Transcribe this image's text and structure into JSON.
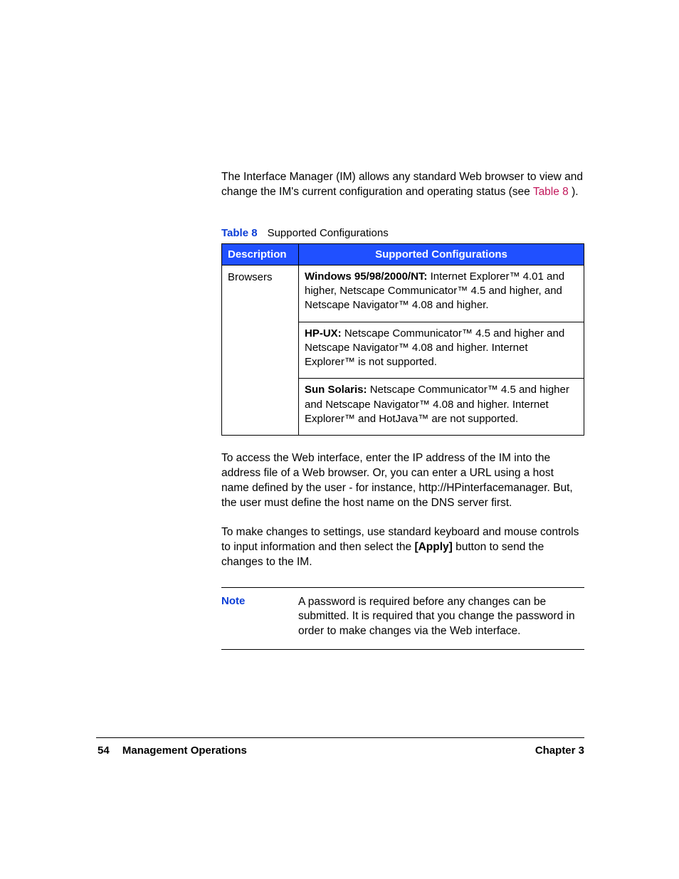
{
  "intro": {
    "before_ref": "The Interface Manager (IM) allows any standard Web browser to view and change the IM's current configuration and operating status (see ",
    "ref": "Table 8",
    "after_ref": " )."
  },
  "caption": {
    "label": "Table 8",
    "title": "Supported Configurations"
  },
  "table": {
    "headers": [
      "Description",
      "Supported Configurations"
    ],
    "row_label": "Browsers",
    "blocks": [
      {
        "lead": "Windows 95/98/2000/NT:",
        "rest": " Internet Explorer™ 4.01 and higher, Netscape Communicator™ 4.5 and higher, and Netscape Navigator™ 4.08 and higher."
      },
      {
        "lead": "HP-UX:",
        "rest": " Netscape Communicator™ 4.5 and higher and Netscape Navigator™ 4.08 and higher. Internet Explorer™ is not supported."
      },
      {
        "lead": "Sun Solaris:",
        "rest": " Netscape Communicator™ 4.5 and higher and Netscape Navigator™ 4.08 and higher. Internet Explorer™ and HotJava™ are not supported."
      }
    ]
  },
  "para1": "To access the Web interface, enter the IP address of the IM into the address file of a Web browser. Or, you can enter a URL using a host name defined by the user - for instance, http://HPinterfacemanager. But, the user must define the host name on the DNS server first.",
  "para2": {
    "pre": "To make changes to settings, use standard keyboard and mouse controls to input information and then select the ",
    "btn": "[Apply]",
    "post": "  button to send the changes to the IM."
  },
  "note": {
    "label": "Note",
    "text": "A password is required before any changes can be submitted. It is required that you change the password in order to make changes via the Web interface."
  },
  "footer": {
    "page": "54",
    "section": "Management Operations",
    "chapter": "Chapter 3"
  }
}
